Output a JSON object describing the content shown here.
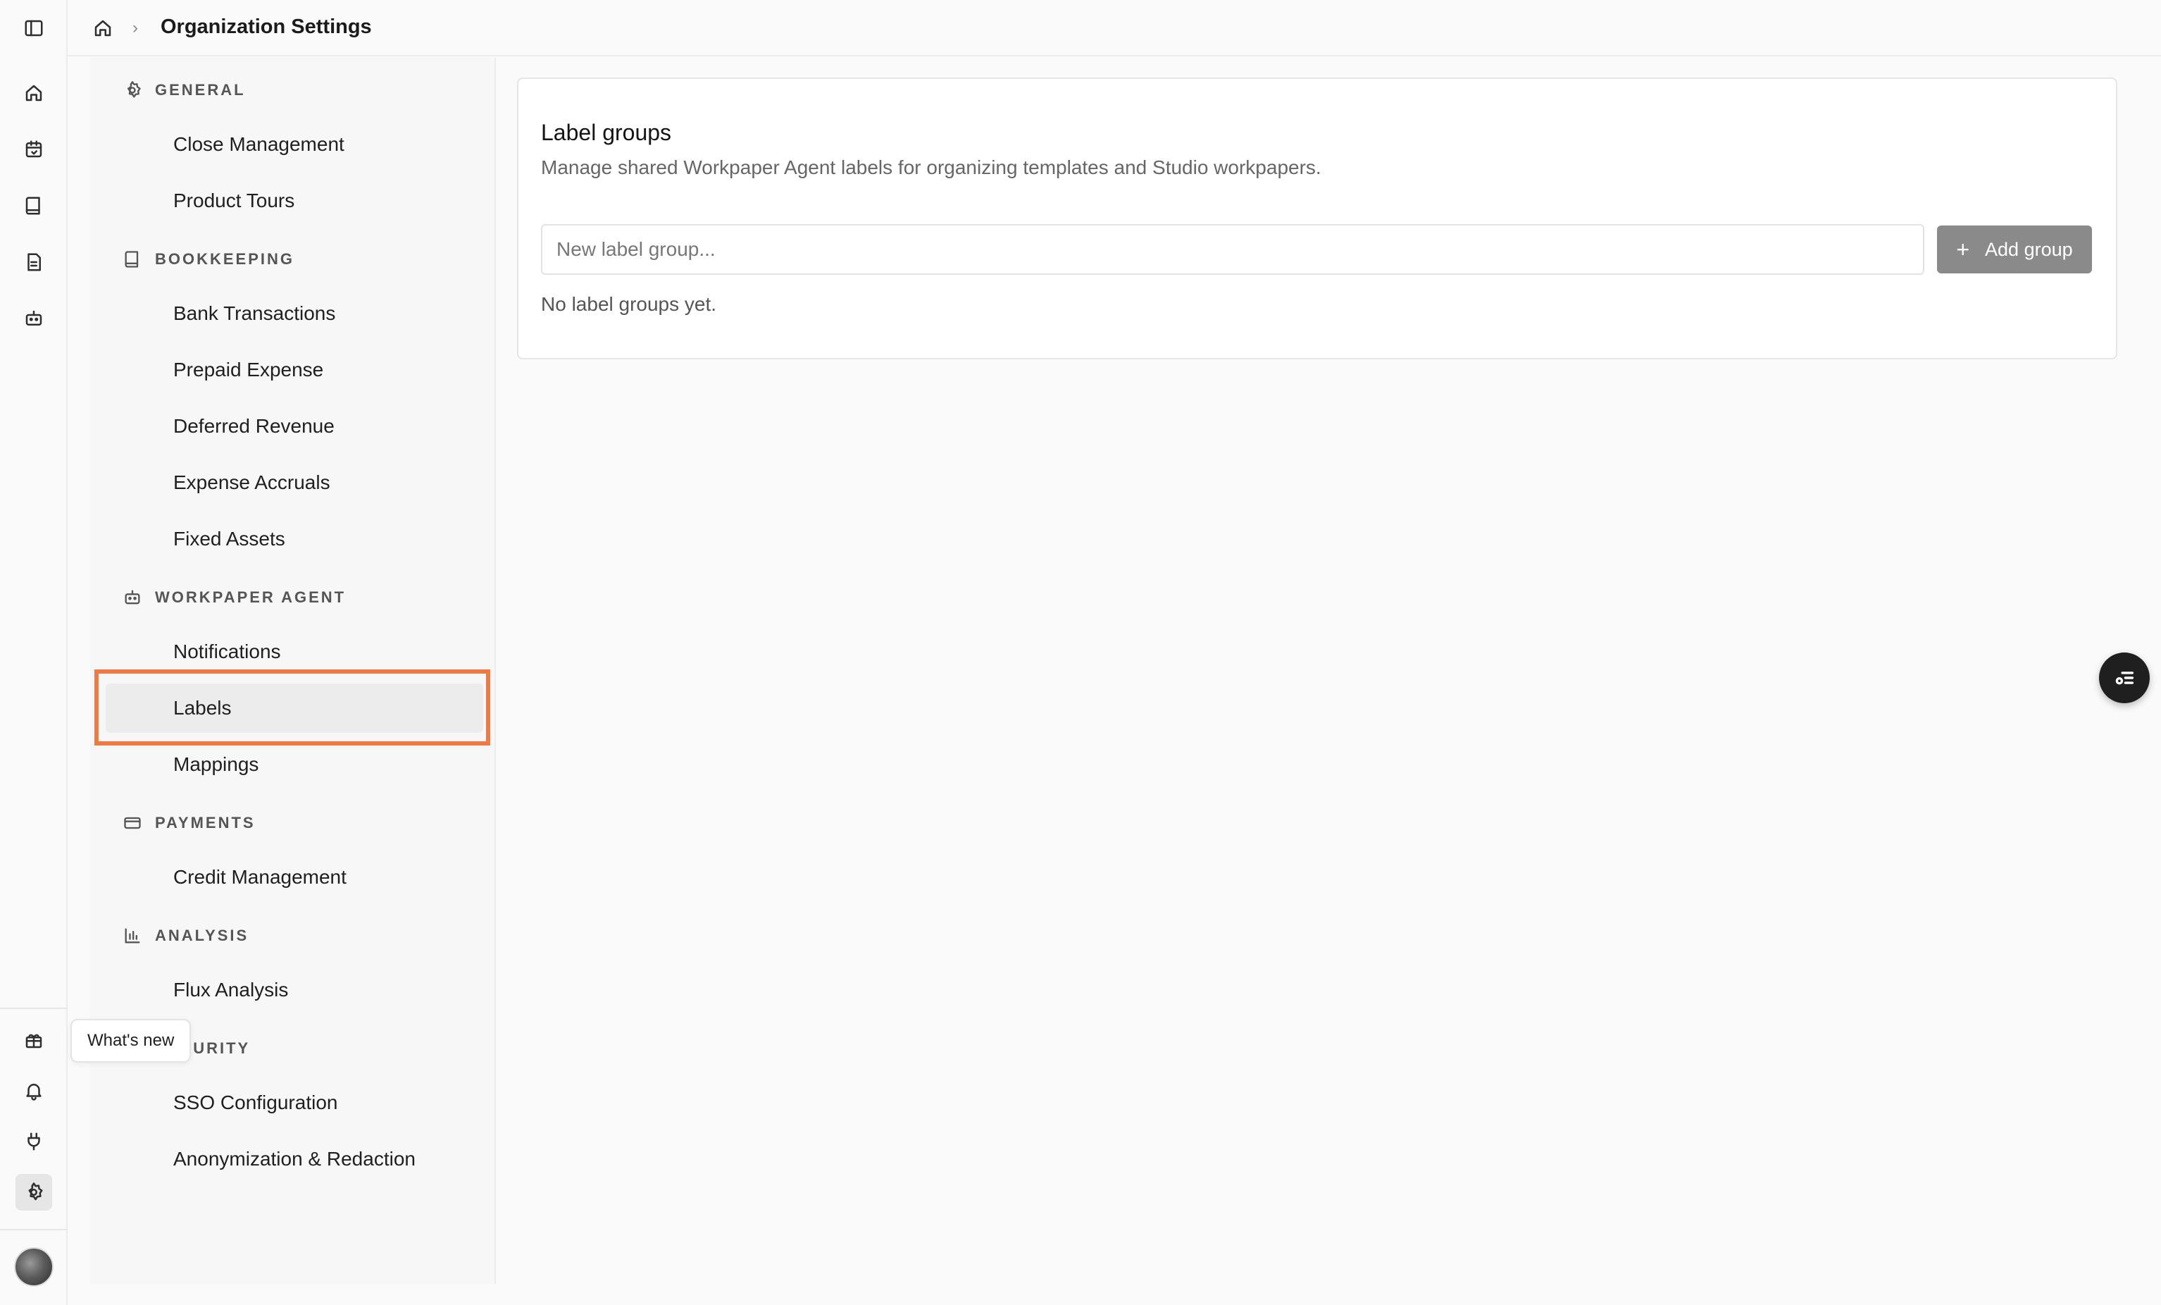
{
  "header": {
    "title": "Organization Settings"
  },
  "tooltip": {
    "text": "What's new"
  },
  "settings_nav": {
    "sections": [
      {
        "label": "GENERAL",
        "icon": "gear-icon",
        "items": [
          "Close Management",
          "Product Tours"
        ]
      },
      {
        "label": "BOOKKEEPING",
        "icon": "book-icon",
        "items": [
          "Bank Transactions",
          "Prepaid Expense",
          "Deferred Revenue",
          "Expense Accruals",
          "Fixed Assets"
        ]
      },
      {
        "label": "WORKPAPER AGENT",
        "icon": "bot-icon",
        "items": [
          "Notifications",
          "Labels",
          "Mappings"
        ]
      },
      {
        "label": "PAYMENTS",
        "icon": "credit-card-icon",
        "items": [
          "Credit Management"
        ]
      },
      {
        "label": "ANALYSIS",
        "icon": "bar-chart-icon",
        "items": [
          "Flux Analysis"
        ]
      },
      {
        "label": "SECURITY",
        "icon": "shield-icon",
        "items": [
          "SSO Configuration",
          "Anonymization & Redaction"
        ]
      }
    ],
    "selected": "Labels"
  },
  "card": {
    "title": "Label groups",
    "description": "Manage shared Workpaper Agent labels for organizing templates and Studio workpapers.",
    "input_placeholder": "New label group...",
    "input_value": "",
    "add_button_label": "Add group",
    "empty_text": "No label groups yet."
  },
  "colors": {
    "highlight": "#f07a45",
    "button_disabled": "#8a8a8a",
    "fab": "#1f1f1f"
  }
}
